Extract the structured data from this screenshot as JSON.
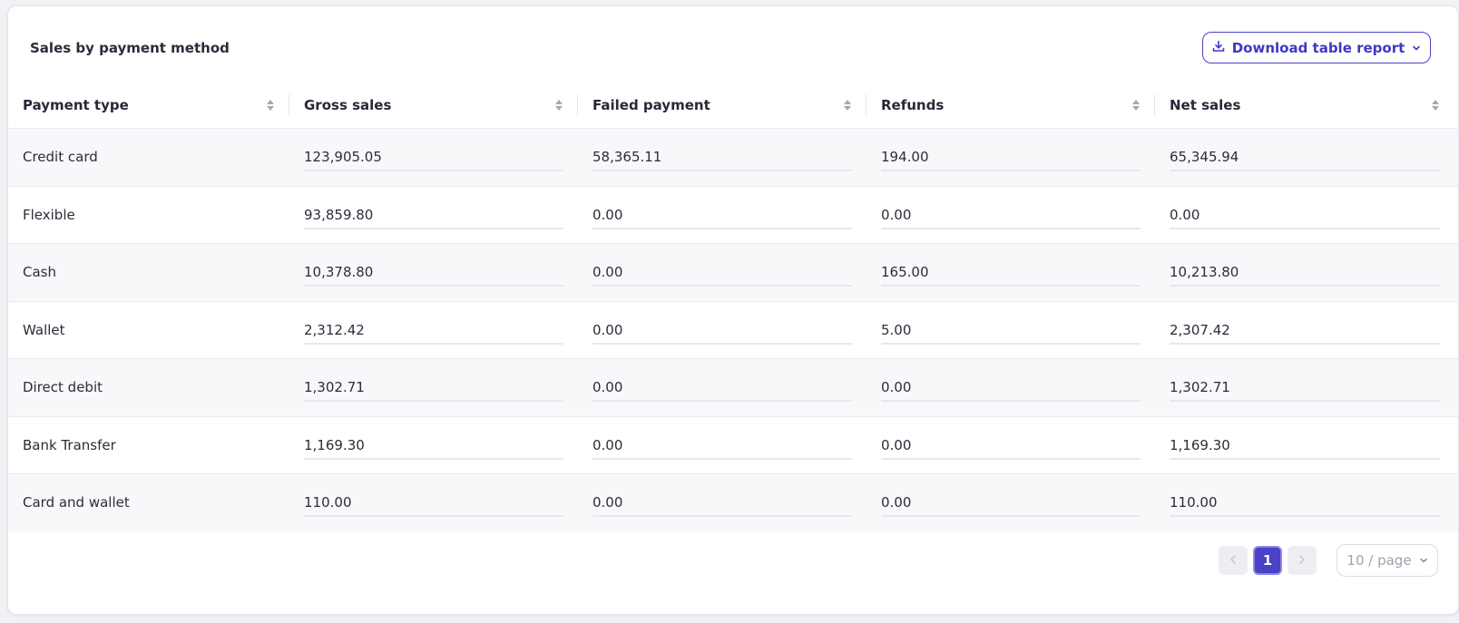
{
  "header": {
    "title": "Sales by payment method",
    "download_label": "Download table report"
  },
  "table": {
    "columns": [
      "Payment type",
      "Gross sales",
      "Failed payment",
      "Refunds",
      "Net sales"
    ],
    "rows": [
      [
        "Credit card",
        "123,905.05",
        "58,365.11",
        "194.00",
        "65,345.94"
      ],
      [
        "Flexible",
        "93,859.80",
        "0.00",
        "0.00",
        "0.00"
      ],
      [
        "Cash",
        "10,378.80",
        "0.00",
        "165.00",
        "10,213.80"
      ],
      [
        "Wallet",
        "2,312.42",
        "0.00",
        "5.00",
        "2,307.42"
      ],
      [
        "Direct debit",
        "1,302.71",
        "0.00",
        "0.00",
        "1,302.71"
      ],
      [
        "Bank Transfer",
        "1,169.30",
        "0.00",
        "0.00",
        "1,169.30"
      ],
      [
        "Card and wallet",
        "110.00",
        "0.00",
        "0.00",
        "110.00"
      ]
    ]
  },
  "pagination": {
    "current_page": "1",
    "page_size_label": "10 / page"
  },
  "colors": {
    "accent": "#4a41c9",
    "row_alt": "#f8f8fb"
  },
  "icons": {
    "download": "download-icon",
    "dropdown": "chevron-down-icon",
    "sort": "sort-icon",
    "prev": "chevron-left-icon",
    "next": "chevron-right-icon"
  }
}
